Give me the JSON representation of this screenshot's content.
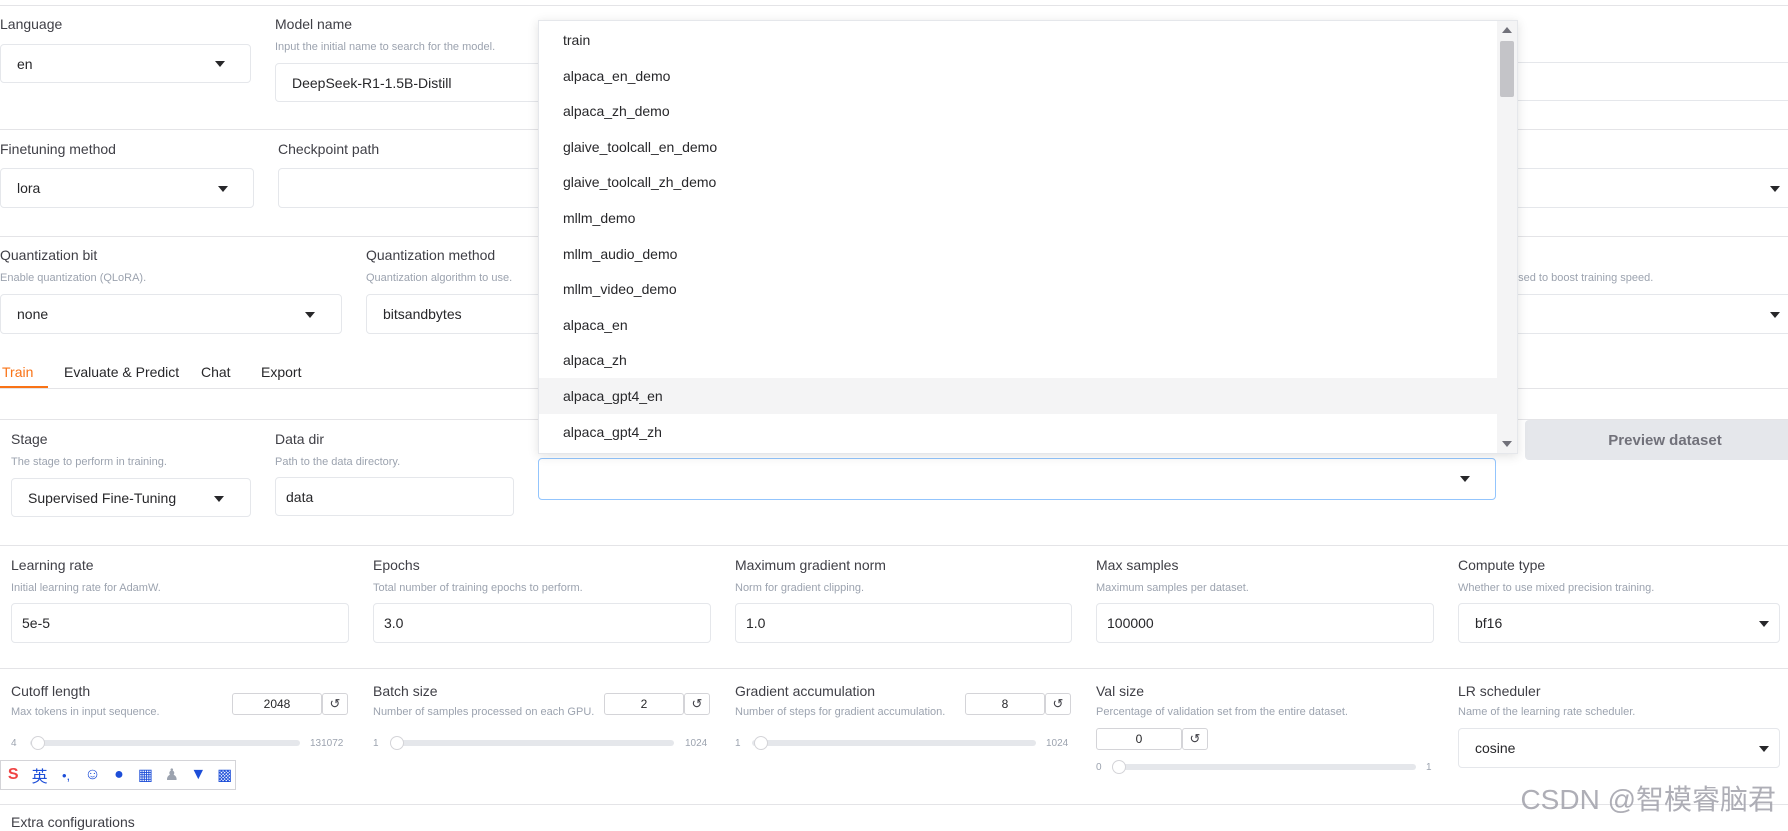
{
  "top": {
    "language": {
      "label": "Language",
      "value": "en"
    },
    "model_name": {
      "label": "Model name",
      "info": "Input the initial name to search for the model.",
      "value": "DeepSeek-R1-1.5B-Distill"
    },
    "finetuning_method": {
      "label": "Finetuning method",
      "value": "lora"
    },
    "checkpoint_path": {
      "label": "Checkpoint path",
      "value": ""
    },
    "quantization_bit": {
      "label": "Quantization bit",
      "info": "Enable quantization (QLoRA).",
      "value": "none"
    },
    "quantization_method": {
      "label": "Quantization method",
      "info": "Quantization algorithm to use.",
      "value": "bitsandbytes"
    },
    "booster_info": "used to boost training speed."
  },
  "tabs": [
    "Train",
    "Evaluate & Predict",
    "Chat",
    "Export"
  ],
  "train": {
    "stage": {
      "label": "Stage",
      "info": "The stage to perform in training.",
      "value": "Supervised Fine-Tuning"
    },
    "data_dir": {
      "label": "Data dir",
      "info": "Path to the data directory.",
      "value": "data"
    },
    "dataset_value": "",
    "preview_button": "Preview dataset",
    "learning_rate": {
      "label": "Learning rate",
      "info": "Initial learning rate for AdamW.",
      "value": "5e-5"
    },
    "epochs": {
      "label": "Epochs",
      "info": "Total number of training epochs to perform.",
      "value": "3.0"
    },
    "max_grad_norm": {
      "label": "Maximum gradient norm",
      "info": "Norm for gradient clipping.",
      "value": "1.0"
    },
    "max_samples": {
      "label": "Max samples",
      "info": "Maximum samples per dataset.",
      "value": "100000"
    },
    "compute_type": {
      "label": "Compute type",
      "info": "Whether to use mixed precision training.",
      "value": "bf16"
    },
    "cutoff_len": {
      "label": "Cutoff length",
      "info": "Max tokens in input sequence.",
      "value": "2048",
      "min": "4",
      "max": "131072",
      "fraction": 0.003
    },
    "batch_size": {
      "label": "Batch size",
      "info": "Number of samples processed on each GPU.",
      "value": "2",
      "min": "1",
      "max": "1024",
      "fraction": 0.001
    },
    "grad_accum": {
      "label": "Gradient accumulation",
      "info": "Number of steps for gradient accumulation.",
      "value": "8",
      "min": "1",
      "max": "1024",
      "fraction": 0.007
    },
    "val_size": {
      "label": "Val size",
      "info": "Percentage of validation set from the entire dataset.",
      "value": "0",
      "min": "0",
      "max": "1",
      "fraction": 0
    },
    "lr_scheduler": {
      "label": "LR scheduler",
      "info": "Name of the learning rate scheduler.",
      "value": "cosine"
    },
    "extra": "Extra configurations",
    "reset_glyph": "↺"
  },
  "dropdown_items": [
    "train",
    "alpaca_en_demo",
    "alpaca_zh_demo",
    "glaive_toolcall_en_demo",
    "glaive_toolcall_zh_demo",
    "mllm_demo",
    "mllm_audio_demo",
    "mllm_video_demo",
    "alpaca_en",
    "alpaca_zh",
    "alpaca_gpt4_en",
    "alpaca_gpt4_zh"
  ],
  "dropdown_highlight_index": 10,
  "ime": {
    "lang": "英",
    "punct": "•,"
  },
  "watermark": "CSDN @智模睿脑君",
  "colors": {
    "accent": "#f97316"
  }
}
